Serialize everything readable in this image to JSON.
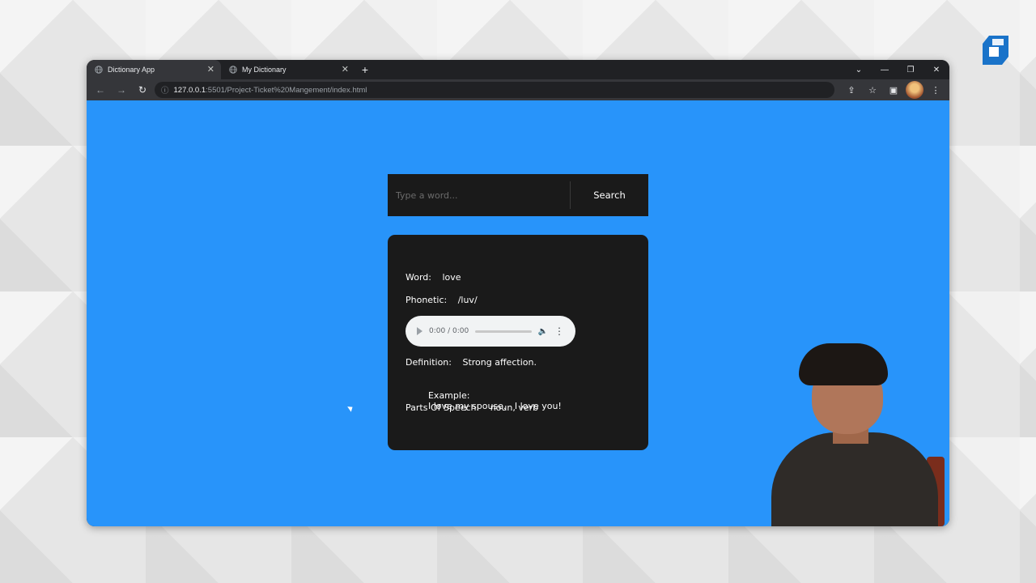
{
  "browser": {
    "tabs": [
      {
        "label": "Dictionary App",
        "active": true
      },
      {
        "label": "My Dictionary",
        "active": false
      }
    ],
    "new_tab_label": "+",
    "address_host": "127.0.0.1",
    "address_path": ":5501/Project-Ticket%20Mangement/index.html",
    "window_controls": {
      "dropdown": "⌄",
      "minimize": "—",
      "restore": "❐",
      "close": "✕"
    }
  },
  "search": {
    "placeholder": "Type a word...",
    "value": "",
    "button_label": "Search"
  },
  "result": {
    "word_label": "Word:",
    "word": "love",
    "phonetic_label": "Phonetic:",
    "phonetic": "/luv/",
    "audio_time": "0:00 / 0:00",
    "definition_label": "Definition:",
    "definition": "Strong affection.",
    "example_label": "Example:",
    "example": "I love my spouse.   I love you!",
    "pos_label": "Parts Of Speech:",
    "pos": "noun, verb"
  },
  "colors": {
    "page_bg": "#2894fa",
    "panel_bg": "#1a1a1a",
    "chrome_bg": "#202124"
  },
  "icons": [
    "globe-icon",
    "close-icon",
    "plus-icon",
    "back-icon",
    "forward-icon",
    "reload-icon",
    "info-icon",
    "share-icon",
    "star-icon",
    "sidebar-icon",
    "profile-icon",
    "menu-icon",
    "play-icon",
    "volume-icon",
    "more-icon",
    "logo-icon"
  ]
}
